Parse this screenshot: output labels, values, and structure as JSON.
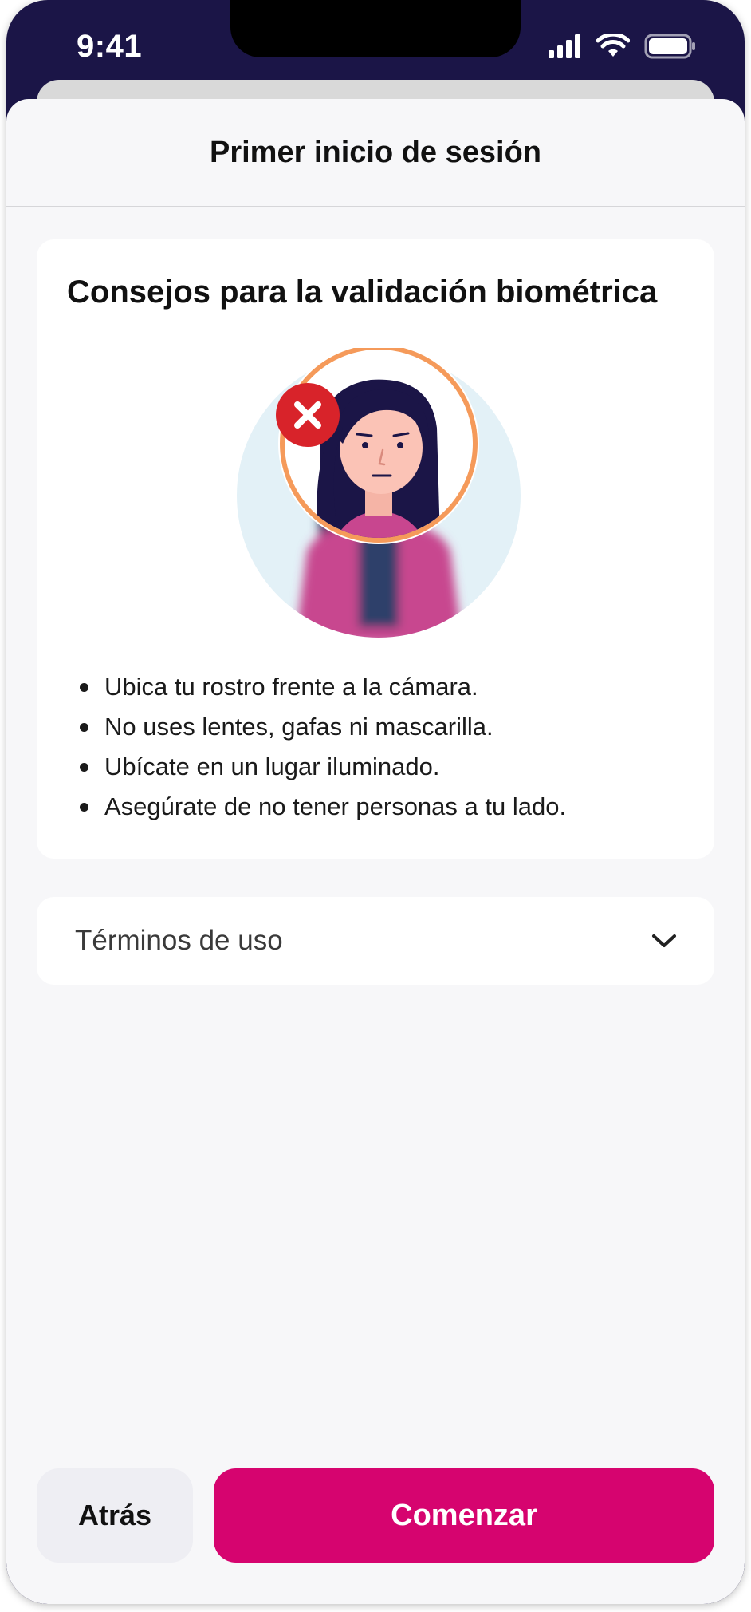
{
  "status_bar": {
    "time": "9:41"
  },
  "header": {
    "title": "Primer inicio de sesión"
  },
  "tips_card": {
    "title": "Consejos para la validación biométrica",
    "illustration": "woman-face-error-icon",
    "tips": [
      "Ubica tu rostro frente a la cámara.",
      "No uses lentes, gafas ni mascarilla.",
      "Ubícate en un lugar iluminado.",
      "Asegúrate de no tener personas a tu lado."
    ]
  },
  "terms": {
    "label": "Términos de uso",
    "icon": "chevron-down-icon"
  },
  "footer": {
    "back_label": "Atrás",
    "start_label": "Comenzar"
  },
  "colors": {
    "status_bar_bg": "#1b1547",
    "primary": "#d6046f",
    "secondary_button_bg": "#eeeef3",
    "sheet_bg": "#f7f7f9",
    "error": "#d8232a",
    "ring": "#f59a5a"
  }
}
